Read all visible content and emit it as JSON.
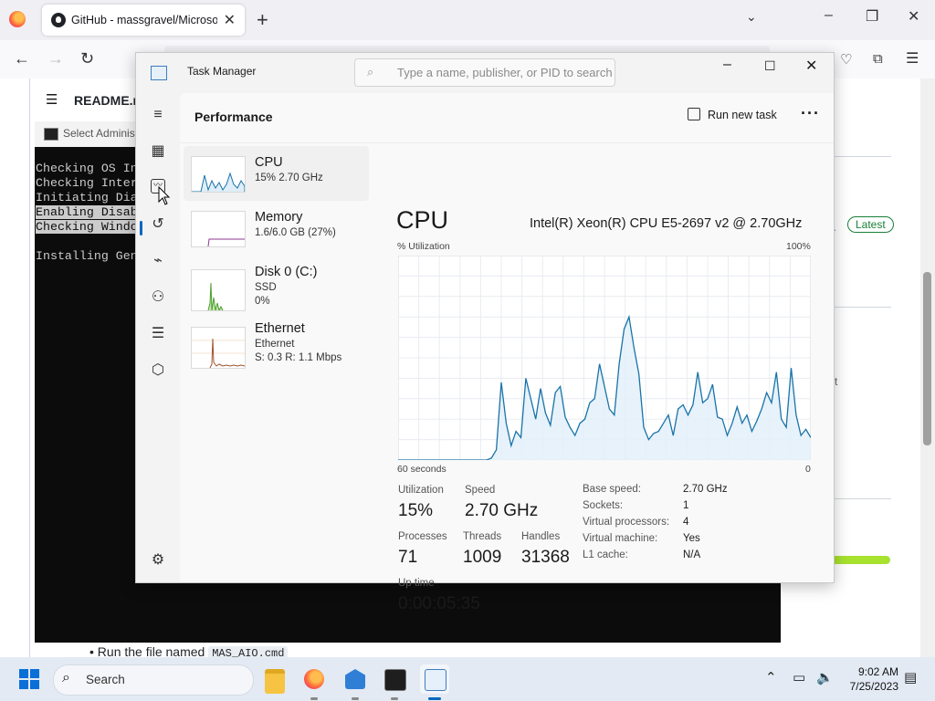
{
  "browser": {
    "tab_title": "GitHub - massgravel/Microsoft-Activation-Scripts",
    "tab_close": "✕",
    "new_tab": "+",
    "tab_list": "⌄",
    "minimize": "–",
    "restore": "❐",
    "close": "✕",
    "back": "←",
    "forward": "→",
    "reload": "↻"
  },
  "webpage": {
    "readme_label": "README.md",
    "latest_badge": "Latest",
    "ellipsis": "..",
    "right_fragment": "rt",
    "bullet_prefix": "Run the file named",
    "bullet_code": "MAS_AIO.cmd"
  },
  "console": {
    "title": "Select Administrator: MAS_AIO",
    "lines": {
      "l1": "Checking OS Info",
      "l2": "Checking Internet Connection",
      "l3": "Initiating Diagnostic Tests...",
      "l4": "Enabling Disabled Services",
      "l5": "Checking Windows Update",
      "l6": "",
      "l7": "Installing Generic Product Key"
    }
  },
  "taskmanager": {
    "title": "Task Manager",
    "search_placeholder": "Type a name, publisher, or PID to search",
    "section": "Performance",
    "run_new_task": "Run new task",
    "more": "···",
    "resources": [
      {
        "name": "CPU",
        "sub1": "15% 2.70 GHz",
        "sub2": "",
        "sub3": ""
      },
      {
        "name": "Memory",
        "sub1": "1.6/6.0 GB (27%)",
        "sub2": "",
        "sub3": ""
      },
      {
        "name": "Disk 0 (C:)",
        "sub1": "SSD",
        "sub2": "0%",
        "sub3": ""
      },
      {
        "name": "Ethernet",
        "sub1": "Ethernet",
        "sub2": "S: 0.3 R: 1.1 Mbps",
        "sub3": ""
      }
    ],
    "detail": {
      "title": "CPU",
      "model": "Intel(R) Xeon(R) CPU E5-2697 v2 @ 2.70GHz",
      "y_label": "% Utilization",
      "y_max": "100%",
      "x_left": "60 seconds",
      "x_right": "0",
      "utilization_label": "Utilization",
      "utilization": "15%",
      "speed_label": "Speed",
      "speed": "2.70 GHz",
      "processes_label": "Processes",
      "processes": "71",
      "threads_label": "Threads",
      "threads": "1009",
      "handles_label": "Handles",
      "handles": "31368",
      "uptime_label": "Up time",
      "uptime": "0:00:05:35",
      "base_speed_label": "Base speed:",
      "base_speed": "2.70 GHz",
      "sockets_label": "Sockets:",
      "sockets": "1",
      "vproc_label": "Virtual processors:",
      "vproc": "4",
      "vm_label": "Virtual machine:",
      "vm": "Yes",
      "l1_label": "L1 cache:",
      "l1": "N/A"
    },
    "cpu_history": [
      0,
      0,
      0,
      0,
      0,
      0,
      0,
      0,
      0,
      0,
      0,
      0,
      0,
      0,
      0,
      0,
      0,
      0,
      0,
      1,
      5,
      38,
      18,
      7,
      14,
      11,
      40,
      30,
      20,
      35,
      23,
      17,
      33,
      36,
      21,
      16,
      12,
      18,
      20,
      28,
      30,
      47,
      36,
      25,
      22,
      47,
      64,
      70,
      55,
      42,
      16,
      10,
      13,
      14,
      18,
      22,
      12,
      25,
      27,
      22,
      27,
      43,
      28,
      30,
      37,
      21,
      20,
      12,
      18,
      26,
      18,
      22,
      14,
      19,
      25,
      33,
      28,
      43,
      20,
      16,
      45,
      22,
      12,
      15,
      11
    ],
    "accent_color": "#1a73a8"
  },
  "taskbar": {
    "search": "Search",
    "time": "9:02 AM",
    "date": "7/25/2023"
  }
}
